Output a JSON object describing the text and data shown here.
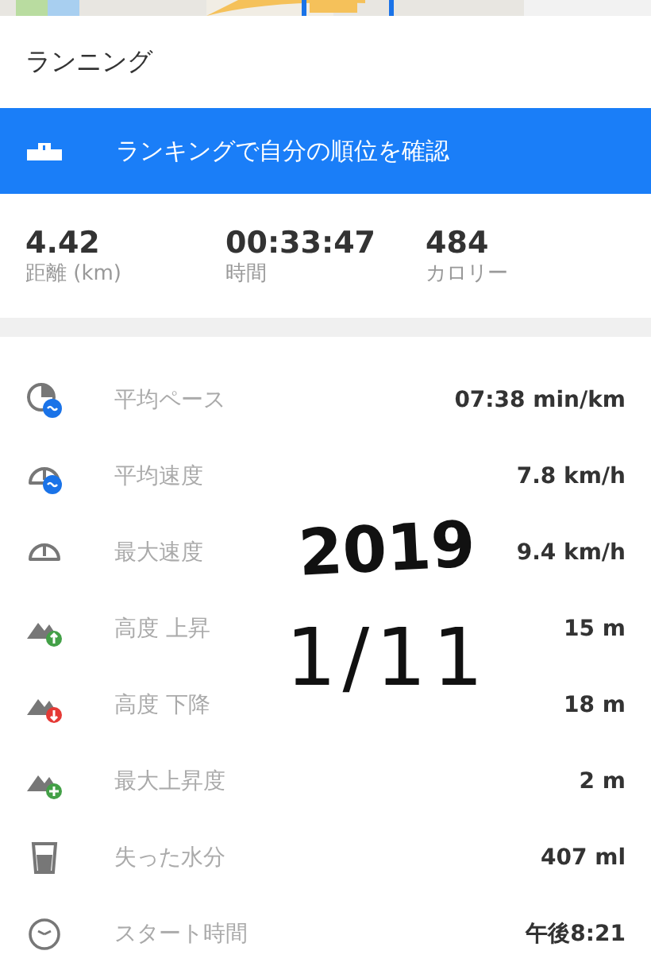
{
  "map": {
    "kind": "picture"
  },
  "title": "ランニング",
  "banner": {
    "label": "ランキングで自分の順位を確認"
  },
  "summary": [
    {
      "value": "4.42",
      "label": "距離 (km)"
    },
    {
      "value": "00:33:47",
      "label": "時間"
    },
    {
      "value": "484",
      "label": "カロリー"
    }
  ],
  "details": [
    {
      "kind": "pace",
      "label": "平均ペース",
      "value": "07:38 min/km"
    },
    {
      "kind": "speed",
      "label": "平均速度",
      "value": "7.8 km/h"
    },
    {
      "kind": "max_speed",
      "label": "最大速度",
      "value": "9.4 km/h"
    },
    {
      "kind": "ascent",
      "label": "高度 上昇",
      "value": "15 m"
    },
    {
      "kind": "descent",
      "label": "高度 下降",
      "value": "18 m"
    },
    {
      "kind": "max_climb",
      "label": "最大上昇度",
      "value": "2 m"
    },
    {
      "kind": "water",
      "label": "失った水分",
      "value": "407 ml"
    },
    {
      "kind": "clock",
      "label": "スタート時間",
      "value": "午後8:21"
    }
  ],
  "handwritten_note": [
    "2019",
    "1/11"
  ]
}
